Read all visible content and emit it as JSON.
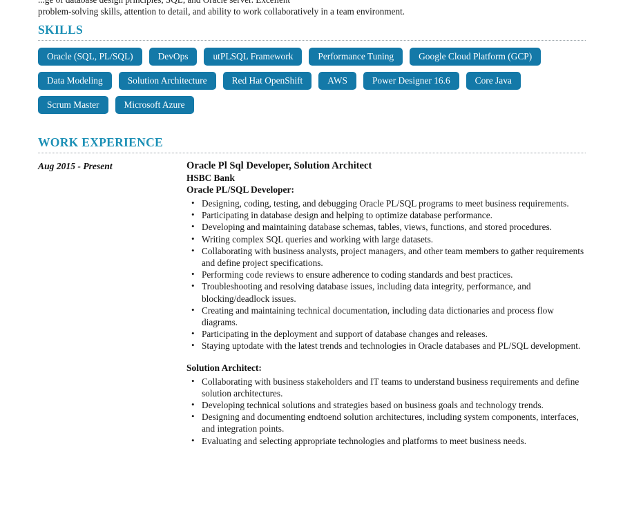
{
  "document": {
    "type": "resume",
    "accent_color": "#1a8fb5",
    "chip_color": "#1479a8",
    "text_color": "#1a1a1a"
  },
  "intro": {
    "line_clipped": "...ge of database design principles, SQL, and Oracle server. Excellent",
    "line_visible": "problem-solving skills, attention to detail, and ability to work collaboratively in a team environment."
  },
  "skills": {
    "heading": "SKILLS",
    "items": [
      "Oracle (SQL, PL/SQL)",
      "DevOps",
      "utPLSQL Framework",
      "Performance Tuning",
      "Google Cloud Platform (GCP)",
      "Data Modeling",
      "Solution Architecture",
      "Red Hat OpenShift",
      "AWS",
      "Power Designer 16.6",
      "Core Java",
      "Scrum Master",
      "Microsoft Azure"
    ]
  },
  "work_experience": {
    "heading": "WORK EXPERIENCE",
    "entries": [
      {
        "date_range": "Aug 2015 - Present",
        "job_title": "Oracle Pl Sql Developer, Solution Architect",
        "company": "HSBC Bank",
        "roles": [
          {
            "role_heading": "Oracle PL/SQL Developer:",
            "duties": [
              "Designing, coding, testing, and debugging Oracle PL/SQL programs to meet business requirements.",
              "Participating in database design and helping to optimize database performance.",
              "Developing and maintaining database schemas, tables, views, functions, and stored procedures.",
              "Writing complex SQL queries and working with large datasets.",
              "Collaborating with business analysts, project managers, and other team members to gather requirements and define project specifications.",
              "Performing code reviews to ensure adherence to coding standards and best practices.",
              "Troubleshooting and resolving database issues, including data integrity, performance, and blocking/deadlock issues.",
              "Creating and maintaining technical documentation, including data dictionaries and process flow diagrams.",
              "Participating in the deployment and support of database changes and releases.",
              "Staying uptodate with the latest trends and technologies in Oracle databases and PL/SQL development."
            ]
          },
          {
            "role_heading": "Solution Architect:",
            "duties": [
              "Collaborating with business stakeholders and IT teams to understand business requirements and define solution architectures.",
              "Developing technical solutions and strategies based on business goals and technology trends.",
              "Designing and documenting endtoend solution architectures, including system components, interfaces, and integration points.",
              "Evaluating and selecting appropriate technologies and platforms to meet business needs."
            ]
          }
        ]
      }
    ]
  }
}
